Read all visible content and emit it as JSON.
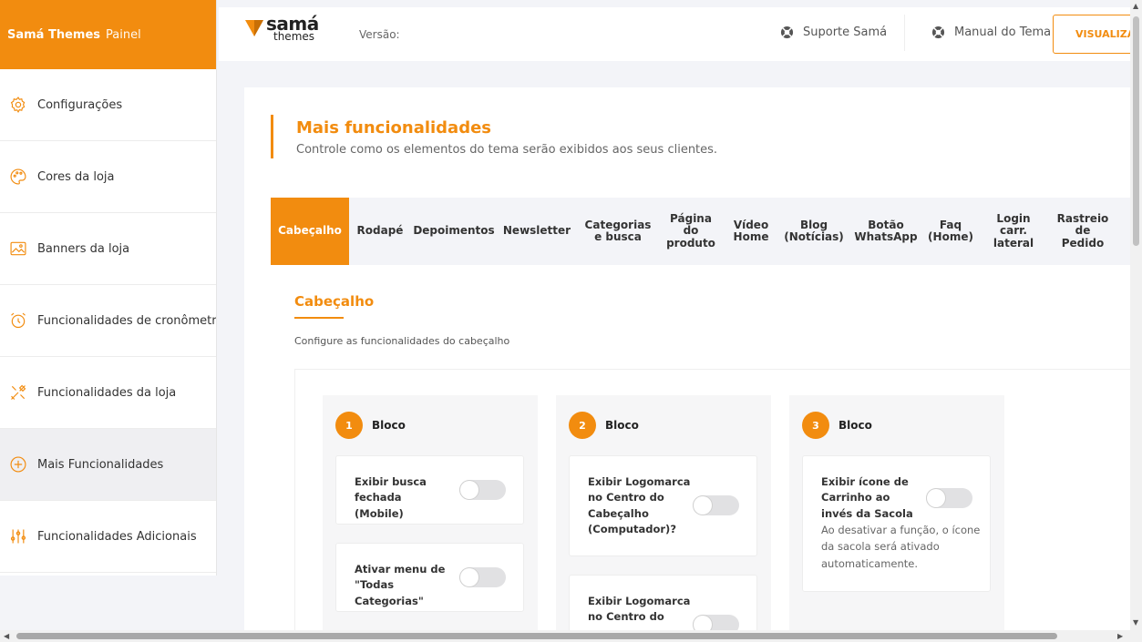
{
  "brand": {
    "name": "Samá Themes",
    "suffix": "Painel"
  },
  "sidebar": {
    "items": [
      {
        "label": "Configurações",
        "icon": "gear-icon"
      },
      {
        "label": "Cores da loja",
        "icon": "palette-icon"
      },
      {
        "label": "Banners da loja",
        "icon": "image-icon"
      },
      {
        "label": "Funcionalidades de cronômetros",
        "icon": "alarm-clock-icon"
      },
      {
        "label": "Funcionalidades da loja",
        "icon": "tools-icon"
      },
      {
        "label": "Mais Funcionalidades",
        "icon": "plus-circle-icon",
        "active": true
      },
      {
        "label": "Funcionalidades Adicionais",
        "icon": "sliders-icon"
      }
    ]
  },
  "topbar": {
    "logo_line1": "samá",
    "logo_line2": "themes",
    "version_label": "Versão:",
    "support_label": "Suporte Samá",
    "manual_label": "Manual do Tema",
    "view_button": "VISUALIZAR"
  },
  "main": {
    "title": "Mais funcionalidades",
    "subtitle": "Controle como os elementos do tema serão exibidos aos seus clientes.",
    "tabs": [
      {
        "label": "Cabeçalho",
        "active": true
      },
      {
        "label": "Rodapé"
      },
      {
        "label": "Depoimentos"
      },
      {
        "label": "Newsletter"
      },
      {
        "label": "Categorias\ne busca"
      },
      {
        "label": "Página\ndo\nproduto"
      },
      {
        "label": "Vídeo\nHome"
      },
      {
        "label": "Blog\n(Notícias)"
      },
      {
        "label": "Botão\nWhatsApp"
      },
      {
        "label": "Faq\n(Home)"
      },
      {
        "label": "Login\ncarr.\nlateral"
      },
      {
        "label": "Rastreio\nde\nPedido"
      }
    ],
    "section": {
      "title": "Cabeçalho",
      "description": "Configure as funcionalidades do cabeçalho"
    },
    "blocks": [
      {
        "number": "1",
        "label": "Bloco",
        "options": [
          {
            "label": "Exibir busca fechada (Mobile)",
            "on": false
          },
          {
            "label": "Ativar menu de \"Todas Categorias\"",
            "on": false
          }
        ]
      },
      {
        "number": "2",
        "label": "Bloco",
        "options": [
          {
            "label": "Exibir Logomarca no Centro do Cabeçalho (Computador)?",
            "on": false
          },
          {
            "label": "Exibir Logomarca no Centro do",
            "on": false
          }
        ]
      },
      {
        "number": "3",
        "label": "Bloco",
        "options": [
          {
            "label": "Exibir ícone de Carrinho ao invés da Sacola",
            "note": "Ao desativar a função, o ícone da sacola será ativado automaticamente.",
            "on": false
          }
        ]
      }
    ]
  },
  "colors": {
    "accent": "#f28c0f",
    "background": "#f3f4f8",
    "toggle_off": "#e1e1e3"
  }
}
